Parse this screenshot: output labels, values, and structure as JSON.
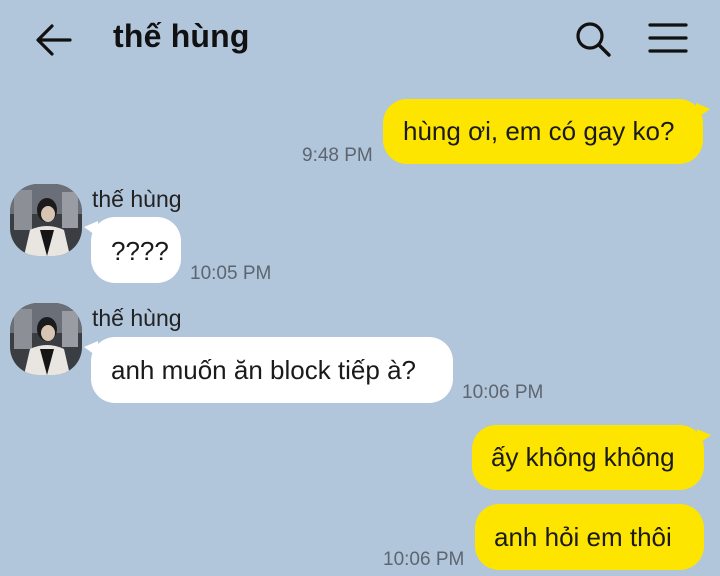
{
  "header": {
    "title": "thế hùng",
    "back_icon": "arrow-left-icon",
    "search_icon": "search-icon",
    "menu_icon": "hamburger-menu-icon"
  },
  "messages": [
    {
      "direction": "out",
      "text": "hùng ơi, em có gay ko?",
      "time": "9:48 PM"
    },
    {
      "direction": "in",
      "sender": "thế hùng",
      "text": "????",
      "time": "10:05 PM"
    },
    {
      "direction": "in",
      "sender": "thế hùng",
      "text": "anh muốn ăn block tiếp à?",
      "time": "10:06 PM"
    },
    {
      "direction": "out",
      "text": "ấy không không",
      "time": ""
    },
    {
      "direction": "out",
      "text": "anh hỏi em thôi",
      "time": "10:06 PM"
    }
  ],
  "colors": {
    "background": "#b1c5db",
    "outgoing_bubble": "#fee500",
    "incoming_bubble": "#ffffff"
  }
}
